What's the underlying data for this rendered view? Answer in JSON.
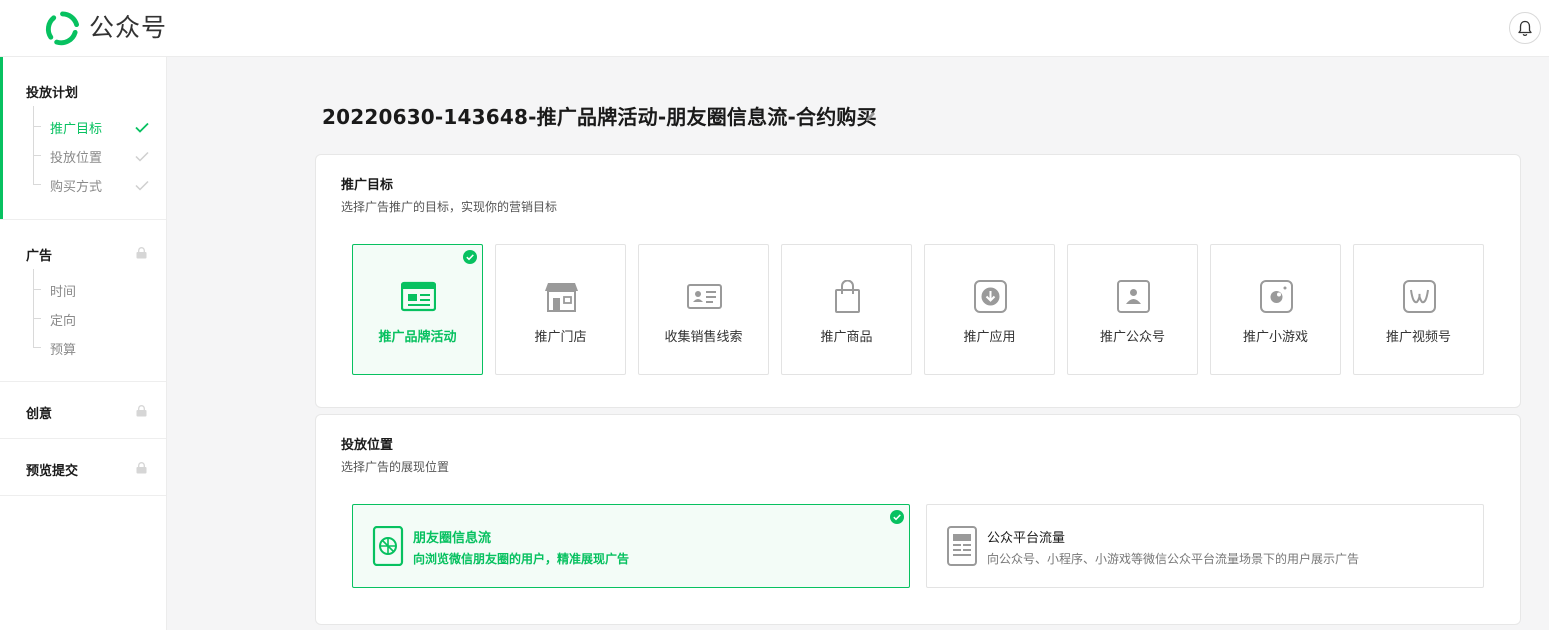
{
  "header": {
    "brand": "公众号"
  },
  "sidebar": {
    "sections": [
      {
        "title": "投放计划",
        "items": [
          "推广目标",
          "投放位置",
          "购买方式"
        ]
      },
      {
        "title": "广告",
        "items": [
          "时间",
          "定向",
          "预算"
        ]
      },
      {
        "title": "创意"
      },
      {
        "title": "预览提交"
      }
    ]
  },
  "main": {
    "title": "20220630-143648-推广品牌活动-朋友圈信息流-合约购买",
    "goal_card": {
      "title": "推广目标",
      "desc": "选择广告推广的目标，实现你的营销目标",
      "options": [
        "推广品牌活动",
        "推广门店",
        "收集销售线索",
        "推广商品",
        "推广应用",
        "推广公众号",
        "推广小游戏",
        "推广视频号"
      ],
      "selected": "推广品牌活动"
    },
    "placement_card": {
      "title": "投放位置",
      "desc": "选择广告的展现位置",
      "options": [
        {
          "title": "朋友圈信息流",
          "desc": "向浏览微信朋友圈的用户，精准展现广告"
        },
        {
          "title": "公众平台流量",
          "desc": "向公众号、小程序、小游戏等微信公众平台流量场景下的用户展示广告"
        }
      ],
      "selected": "朋友圈信息流"
    }
  },
  "colors": {
    "accent": "#07c160",
    "border": "#e3e3e3",
    "icon_gray": "#8c8c8c"
  }
}
